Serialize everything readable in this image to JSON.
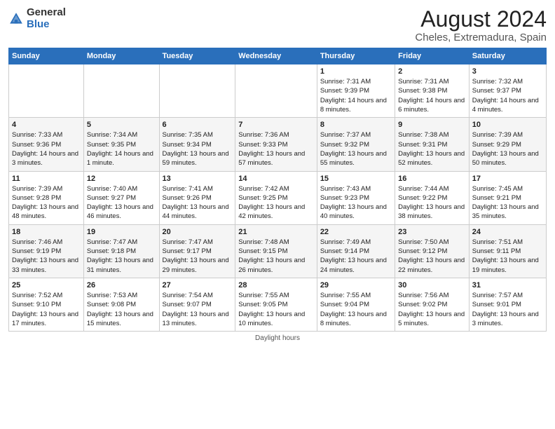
{
  "header": {
    "logo_general": "General",
    "logo_blue": "Blue",
    "title": "August 2024",
    "subtitle": "Cheles, Extremadura, Spain"
  },
  "days_of_week": [
    "Sunday",
    "Monday",
    "Tuesday",
    "Wednesday",
    "Thursday",
    "Friday",
    "Saturday"
  ],
  "footer": {
    "daylight_label": "Daylight hours"
  },
  "weeks": [
    [
      {
        "day": "",
        "sunrise": "",
        "sunset": "",
        "daylight": ""
      },
      {
        "day": "",
        "sunrise": "",
        "sunset": "",
        "daylight": ""
      },
      {
        "day": "",
        "sunrise": "",
        "sunset": "",
        "daylight": ""
      },
      {
        "day": "",
        "sunrise": "",
        "sunset": "",
        "daylight": ""
      },
      {
        "day": "1",
        "sunrise": "Sunrise: 7:31 AM",
        "sunset": "Sunset: 9:39 PM",
        "daylight": "Daylight: 14 hours and 8 minutes."
      },
      {
        "day": "2",
        "sunrise": "Sunrise: 7:31 AM",
        "sunset": "Sunset: 9:38 PM",
        "daylight": "Daylight: 14 hours and 6 minutes."
      },
      {
        "day": "3",
        "sunrise": "Sunrise: 7:32 AM",
        "sunset": "Sunset: 9:37 PM",
        "daylight": "Daylight: 14 hours and 4 minutes."
      }
    ],
    [
      {
        "day": "4",
        "sunrise": "Sunrise: 7:33 AM",
        "sunset": "Sunset: 9:36 PM",
        "daylight": "Daylight: 14 hours and 3 minutes."
      },
      {
        "day": "5",
        "sunrise": "Sunrise: 7:34 AM",
        "sunset": "Sunset: 9:35 PM",
        "daylight": "Daylight: 14 hours and 1 minute."
      },
      {
        "day": "6",
        "sunrise": "Sunrise: 7:35 AM",
        "sunset": "Sunset: 9:34 PM",
        "daylight": "Daylight: 13 hours and 59 minutes."
      },
      {
        "day": "7",
        "sunrise": "Sunrise: 7:36 AM",
        "sunset": "Sunset: 9:33 PM",
        "daylight": "Daylight: 13 hours and 57 minutes."
      },
      {
        "day": "8",
        "sunrise": "Sunrise: 7:37 AM",
        "sunset": "Sunset: 9:32 PM",
        "daylight": "Daylight: 13 hours and 55 minutes."
      },
      {
        "day": "9",
        "sunrise": "Sunrise: 7:38 AM",
        "sunset": "Sunset: 9:31 PM",
        "daylight": "Daylight: 13 hours and 52 minutes."
      },
      {
        "day": "10",
        "sunrise": "Sunrise: 7:39 AM",
        "sunset": "Sunset: 9:29 PM",
        "daylight": "Daylight: 13 hours and 50 minutes."
      }
    ],
    [
      {
        "day": "11",
        "sunrise": "Sunrise: 7:39 AM",
        "sunset": "Sunset: 9:28 PM",
        "daylight": "Daylight: 13 hours and 48 minutes."
      },
      {
        "day": "12",
        "sunrise": "Sunrise: 7:40 AM",
        "sunset": "Sunset: 9:27 PM",
        "daylight": "Daylight: 13 hours and 46 minutes."
      },
      {
        "day": "13",
        "sunrise": "Sunrise: 7:41 AM",
        "sunset": "Sunset: 9:26 PM",
        "daylight": "Daylight: 13 hours and 44 minutes."
      },
      {
        "day": "14",
        "sunrise": "Sunrise: 7:42 AM",
        "sunset": "Sunset: 9:25 PM",
        "daylight": "Daylight: 13 hours and 42 minutes."
      },
      {
        "day": "15",
        "sunrise": "Sunrise: 7:43 AM",
        "sunset": "Sunset: 9:23 PM",
        "daylight": "Daylight: 13 hours and 40 minutes."
      },
      {
        "day": "16",
        "sunrise": "Sunrise: 7:44 AM",
        "sunset": "Sunset: 9:22 PM",
        "daylight": "Daylight: 13 hours and 38 minutes."
      },
      {
        "day": "17",
        "sunrise": "Sunrise: 7:45 AM",
        "sunset": "Sunset: 9:21 PM",
        "daylight": "Daylight: 13 hours and 35 minutes."
      }
    ],
    [
      {
        "day": "18",
        "sunrise": "Sunrise: 7:46 AM",
        "sunset": "Sunset: 9:19 PM",
        "daylight": "Daylight: 13 hours and 33 minutes."
      },
      {
        "day": "19",
        "sunrise": "Sunrise: 7:47 AM",
        "sunset": "Sunset: 9:18 PM",
        "daylight": "Daylight: 13 hours and 31 minutes."
      },
      {
        "day": "20",
        "sunrise": "Sunrise: 7:47 AM",
        "sunset": "Sunset: 9:17 PM",
        "daylight": "Daylight: 13 hours and 29 minutes."
      },
      {
        "day": "21",
        "sunrise": "Sunrise: 7:48 AM",
        "sunset": "Sunset: 9:15 PM",
        "daylight": "Daylight: 13 hours and 26 minutes."
      },
      {
        "day": "22",
        "sunrise": "Sunrise: 7:49 AM",
        "sunset": "Sunset: 9:14 PM",
        "daylight": "Daylight: 13 hours and 24 minutes."
      },
      {
        "day": "23",
        "sunrise": "Sunrise: 7:50 AM",
        "sunset": "Sunset: 9:12 PM",
        "daylight": "Daylight: 13 hours and 22 minutes."
      },
      {
        "day": "24",
        "sunrise": "Sunrise: 7:51 AM",
        "sunset": "Sunset: 9:11 PM",
        "daylight": "Daylight: 13 hours and 19 minutes."
      }
    ],
    [
      {
        "day": "25",
        "sunrise": "Sunrise: 7:52 AM",
        "sunset": "Sunset: 9:10 PM",
        "daylight": "Daylight: 13 hours and 17 minutes."
      },
      {
        "day": "26",
        "sunrise": "Sunrise: 7:53 AM",
        "sunset": "Sunset: 9:08 PM",
        "daylight": "Daylight: 13 hours and 15 minutes."
      },
      {
        "day": "27",
        "sunrise": "Sunrise: 7:54 AM",
        "sunset": "Sunset: 9:07 PM",
        "daylight": "Daylight: 13 hours and 13 minutes."
      },
      {
        "day": "28",
        "sunrise": "Sunrise: 7:55 AM",
        "sunset": "Sunset: 9:05 PM",
        "daylight": "Daylight: 13 hours and 10 minutes."
      },
      {
        "day": "29",
        "sunrise": "Sunrise: 7:55 AM",
        "sunset": "Sunset: 9:04 PM",
        "daylight": "Daylight: 13 hours and 8 minutes."
      },
      {
        "day": "30",
        "sunrise": "Sunrise: 7:56 AM",
        "sunset": "Sunset: 9:02 PM",
        "daylight": "Daylight: 13 hours and 5 minutes."
      },
      {
        "day": "31",
        "sunrise": "Sunrise: 7:57 AM",
        "sunset": "Sunset: 9:01 PM",
        "daylight": "Daylight: 13 hours and 3 minutes."
      }
    ]
  ]
}
